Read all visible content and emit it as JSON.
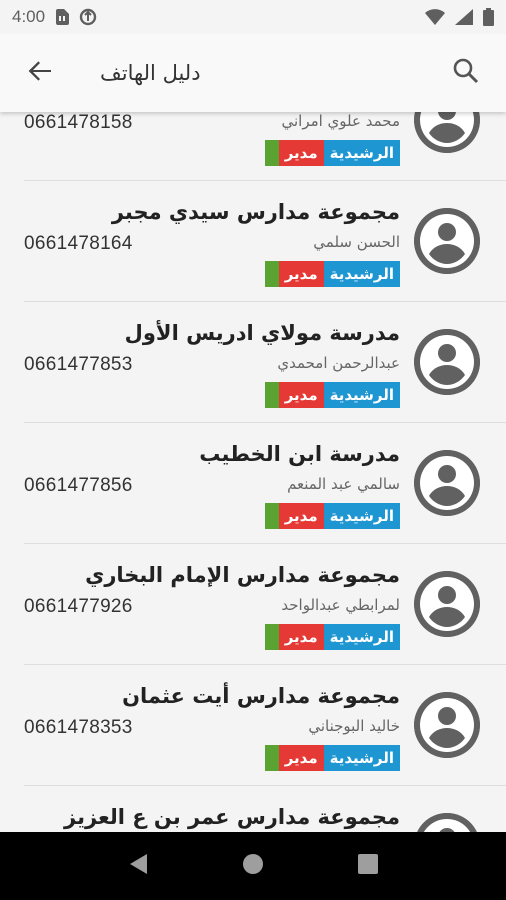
{
  "status_bar": {
    "time": "4:00",
    "icons": [
      "sim-card-icon",
      "data-saver-icon",
      "wifi-icon",
      "signal-icon",
      "battery-icon"
    ]
  },
  "app_bar": {
    "title": "دليل الهاتف",
    "back_icon": "arrow-back-icon",
    "search_icon": "search-icon"
  },
  "colors": {
    "region_tag": "#1e96d2",
    "role_tag": "#e53935",
    "extra_tag": "#5aa332",
    "avatar": "#616161"
  },
  "contacts": [
    {
      "name": "",
      "person": "محمد علوي امراني",
      "phone": "0661478158",
      "region": "الرشيدية",
      "role": "مدير"
    },
    {
      "name": "مجموعة مدارس سيدي مجبر",
      "person": "الحسن سلمي",
      "phone": "0661478164",
      "region": "الرشيدية",
      "role": "مدير"
    },
    {
      "name": "مدرسة مولاي ادريس الأول",
      "person": "عبدالرحمن امحمدي",
      "phone": "0661477853",
      "region": "الرشيدية",
      "role": "مدير"
    },
    {
      "name": "مدرسة ابن الخطيب",
      "person": "سالمي عبد المنعم",
      "phone": "0661477856",
      "region": "الرشيدية",
      "role": "مدير"
    },
    {
      "name": "مجموعة مدارس الإمام البخاري",
      "person": "لمرابطي عبدالواحد",
      "phone": "0661477926",
      "region": "الرشيدية",
      "role": "مدير"
    },
    {
      "name": "مجموعة مدارس أيت عثمان",
      "person": "خاليد البوجناني",
      "phone": "0661478353",
      "region": "الرشيدية",
      "role": "مدير"
    },
    {
      "name": "مجموعة مدارس عمر بن ع العزيز",
      "person": "",
      "phone": "",
      "region": "",
      "role": ""
    }
  ],
  "nav_bar": {
    "back_icon": "nav-back-icon",
    "home_icon": "nav-home-icon",
    "recents_icon": "nav-recents-icon"
  }
}
